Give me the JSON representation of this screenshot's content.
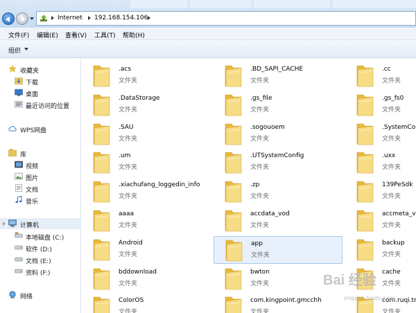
{
  "window": {
    "address": {
      "crumbs": [
        "Internet",
        "192.168.154.106"
      ]
    }
  },
  "menu": {
    "items": [
      "文件(F)",
      "编辑(E)",
      "查看(V)",
      "工具(T)",
      "帮助(H)"
    ]
  },
  "command_bar": {
    "organize_label": "组织"
  },
  "nav_pane": {
    "favorites": {
      "label": "收藏夹",
      "items": [
        "下载",
        "桌面",
        "最近访问的位置"
      ]
    },
    "wps": {
      "label": "WPS网盘"
    },
    "library": {
      "label": "库",
      "items": [
        "视频",
        "图片",
        "文档",
        "音乐"
      ]
    },
    "computer": {
      "label": "计算机",
      "items": [
        "本地磁盘 (C:)",
        "软件 (D:)",
        "文档 (E:)",
        "资料 (F:)"
      ]
    },
    "network": {
      "label": "网络"
    }
  },
  "files": {
    "type_label": "文件夹",
    "items": [
      ".acs",
      ".BD_SAPI_CACHE",
      ".cc",
      ".DataStorage",
      ".gs_file",
      ".gs_fs0",
      ".SAU",
      ".sogouoem",
      ".SystemCon",
      ".um",
      ".UTSystemConfig",
      ".uxx",
      ".xiachufang_loggedin_info",
      ".zp",
      "139PeSdk",
      "aaaa",
      "accdata_vod",
      "accmeta_vo",
      "Android",
      "app",
      "backup",
      "bddownload",
      "bwton",
      "cache",
      "ColorOS",
      "com.kingpoint.gmcchh",
      "com.ruqi.tra"
    ],
    "selected": "app"
  },
  "watermark": {
    "text": "Bai 经验",
    "url": "jingyan.baidu.com"
  },
  "colors": {
    "folder_back": "#e8b93a",
    "folder_front": "#f6dc84",
    "selection": "#e8f1fb",
    "nav_selected": "#e6eef7"
  }
}
